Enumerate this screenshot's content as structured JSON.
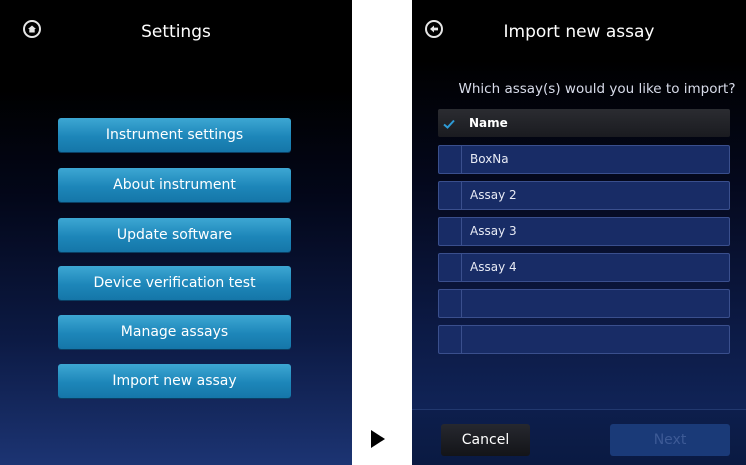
{
  "settings": {
    "title": "Settings",
    "menu": [
      "Instrument settings",
      "About instrument",
      "Update software",
      "Device verification test",
      "Manage assays",
      "Import new assay"
    ],
    "home_icon": "home-icon"
  },
  "import": {
    "title": "Import new assay",
    "back_icon": "back-arrow-icon",
    "question": "Which assay(s) would you like to import?",
    "header_label": "Name",
    "assays": [
      "BoxNa",
      "Assay 2",
      "Assay 3",
      "Assay 4",
      "",
      ""
    ],
    "cancel_label": "Cancel",
    "next_label": "Next"
  },
  "colors": {
    "button_blue": "#1d86b9",
    "check_blue": "#2e9bd6",
    "row_fill": "#182c66"
  },
  "between_icon": "play-arrow-icon"
}
